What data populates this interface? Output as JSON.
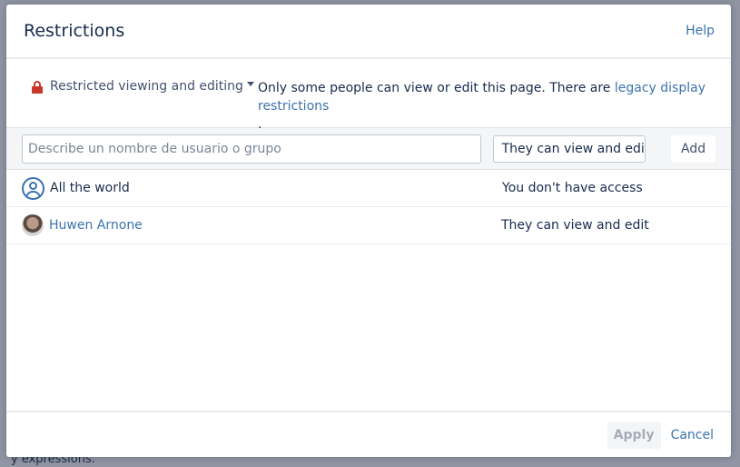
{
  "background": {
    "text": "y expressions."
  },
  "dialog": {
    "title": "Restrictions",
    "help": "Help",
    "mode": "Restricted viewing and editing",
    "description": "Only some people can view or edit this page.  There are ",
    "legacy_link": "legacy display restrictions",
    "description_end": ".",
    "search_placeholder": "Describe un nombre de usuario o grupo",
    "permission_select": "They can view and edi",
    "add": "Add",
    "entries": [
      {
        "name": "All the world",
        "permission": "You don't have access"
      },
      {
        "name": "Huwen Arnone",
        "permission": "They can view and edit"
      }
    ],
    "apply": "Apply",
    "cancel": "Cancel"
  }
}
